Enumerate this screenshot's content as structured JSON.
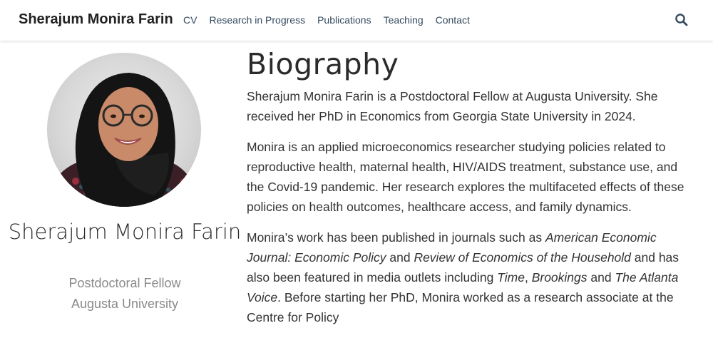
{
  "header": {
    "brand": "Sherajum Monira Farin",
    "nav": [
      {
        "label": "CV"
      },
      {
        "label": "Research in Progress"
      },
      {
        "label": "Publications"
      },
      {
        "label": "Teaching"
      },
      {
        "label": "Contact"
      }
    ],
    "search_icon": "search-icon"
  },
  "profile": {
    "name": "Sherajum Monira Farin",
    "role": "Postdoctoral Fellow",
    "organization": "Augusta University",
    "avatar_icon": "profile-photo"
  },
  "biography": {
    "title": "Biography",
    "p1": "Sherajum Monira Farin is a Postdoctoral Fellow at Augusta University. She received her PhD in Economics from Georgia State University in 2024.",
    "p2": "Monira is an applied microeconomics researcher studying policies related to reproductive health, maternal health, HIV/AIDS treatment, substance use, and the Covid-19 pandemic. Her research explores the multifaceted effects of these policies on health outcomes, healthcare access, and family dynamics.",
    "p3": {
      "t1": "Monira’s work has been published in journals such as ",
      "journal1": "American Economic Journal: Economic Policy",
      "t2": " and ",
      "journal2": "Review of Economics of the Household",
      "t3": " and has also been featured in media outlets including ",
      "media1": "Time",
      "t4": ", ",
      "media2": "Brookings",
      "t5": " and ",
      "media3": "The Atlanta Voice",
      "t6": ". Before starting her PhD, Monira worked as a research associate at the Centre for Policy"
    }
  },
  "colors": {
    "nav_text": "#34495e",
    "brand_text": "#222222",
    "muted_text": "#8a8a8a",
    "body_text": "#333333"
  }
}
